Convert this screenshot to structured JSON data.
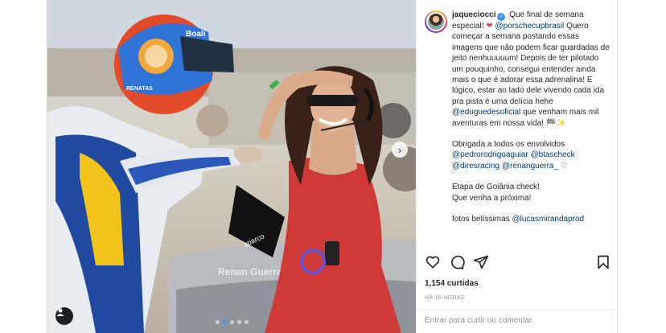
{
  "post": {
    "username": "jaqueciocci",
    "caption_intro": "Que final de semana especial!",
    "mention_porsche": "@porschecupbrasil",
    "caption_body": "Quero começar a semana postando essas imagens que não podem ficar guardadas de jeito nenhuuuuum! Depois de ter pilotado um pouquinho, consegui entender ainda mais o que é adorar essa adrenalina! E lógico, estar ao lado dele vivendo cada ida pra pista é uma delícia hehe",
    "mention_edu": "@eduguedesoficial",
    "caption_after_edu": "que venham mais mil aventuras em nossa vida! 🏁✨",
    "thanks_line": "Obrigada a todos os envolvidos",
    "mention_pedro": "@pedrorodrigoaguiar",
    "mention_bta": "@btascheck",
    "mention_dires": "@diresracing",
    "mention_renan": "@renanguerra_",
    "etapa_line": "Etapa de Goiânia check!",
    "proxima_line": "Que venha a próxima!",
    "fotos_line": "fotos belíssimas",
    "mention_lucas": "@lucasmirandaprod",
    "likes": "1,154 curtidas",
    "time": "HÁ 16 HORAS",
    "comment_placeholder": "Entrar para curtir ou comentar."
  },
  "photo": {
    "helmet_brand": "Boali",
    "helmet_text": "RENATAS",
    "car_name": "Renan Guerra",
    "glove_brand": "sparco",
    "carousel_count": 5,
    "carousel_active": 2
  },
  "icons": {
    "like": "heart-icon",
    "comment": "comment-icon",
    "share": "share-icon",
    "save": "bookmark-icon",
    "next": "chevron-right-icon",
    "tags": "user-tag-icon",
    "verified": "verified-badge-icon"
  },
  "colors": {
    "link": "#00376b",
    "verified": "#3897f0",
    "heart": "#ed4956",
    "carousel_active": "#4a9ff5"
  }
}
